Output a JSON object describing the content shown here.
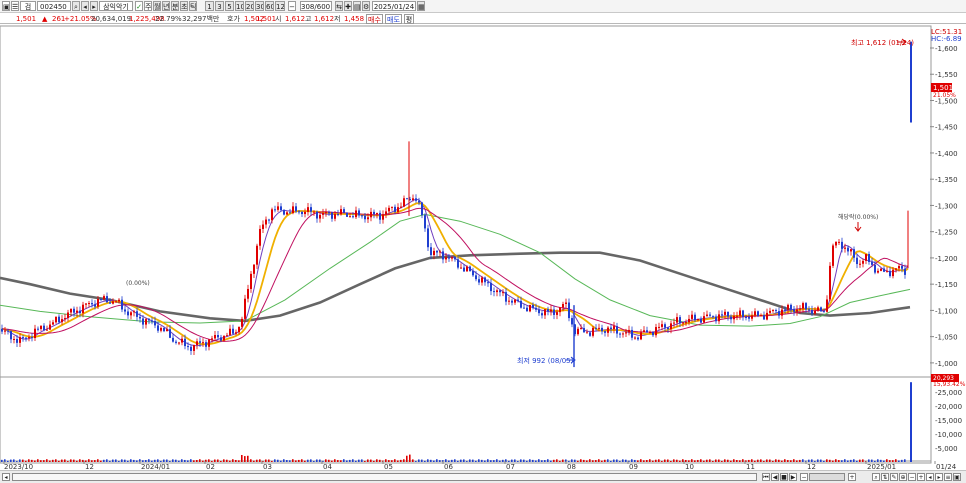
{
  "toolbar": {
    "period_buttons": [
      "1",
      "3",
      "5",
      "10",
      "20",
      "30",
      "60",
      "120"
    ],
    "type_buttons": [
      "주",
      "월",
      "년",
      "분",
      "초",
      "틱"
    ],
    "code": "002450",
    "name": "삼익악기",
    "count": "308",
    "total": "600",
    "date": "2025/01/24"
  },
  "quote": {
    "price": "1,501",
    "change": "261",
    "change_pct": "+21.05%",
    "volume": "20,634,019",
    "value": "1,225,498",
    "turnover": "22.79%",
    "amount": "32,297백만",
    "ask_label": "호가",
    "ask": "1,502",
    "bid": "1,501",
    "open_label": "시",
    "open": "1,612",
    "high_label": "고",
    "high": "1,612",
    "low_label": "저",
    "low": "1,458",
    "buy_button": "매수",
    "sell_button": "매도",
    "eval_button": "평"
  },
  "overlay": {
    "lc": "LC:51.31",
    "hc": "HC:-6.89",
    "max_label": "최고 1,612 (01/24)",
    "min_label": "최저 992 (08/05)",
    "event1": "(0.00%)",
    "event2": "해당락(0.00%)",
    "price_tag": "1,501",
    "price_pct": "21.05%",
    "vol_tag": "20,293",
    "vol_pct": "15,93.42%"
  },
  "colors": {
    "up": "#e00000",
    "down": "#1f3fd0",
    "ma5": "#7040c0",
    "ma10": "#f0b000",
    "ma20": "#c01060",
    "ma60": "#58b858",
    "ma120": "#666666"
  },
  "chart_data": {
    "type": "candlestick",
    "price_axis": {
      "ticks": [
        "1,600",
        "1,550",
        "1,500",
        "1,450",
        "1,400",
        "1,350",
        "1,300",
        "1,250",
        "1,200",
        "1,150",
        "1,100",
        "1,050",
        "1,000"
      ],
      "range": [
        975,
        1640
      ]
    },
    "volume_axis": {
      "ticks": [
        "25,000",
        "20,000",
        "15,000",
        "10,000",
        "5,000"
      ],
      "range": [
        0,
        30000
      ]
    },
    "x_ticks": [
      "2023/10",
      "12",
      "2024/01",
      "02",
      "03",
      "04",
      "05",
      "06",
      "07",
      "08",
      "09",
      "10",
      "11",
      "12",
      "2025/01",
      "01/24"
    ],
    "anchors": [
      [
        0,
        1065
      ],
      [
        10,
        1050
      ],
      [
        22,
        1042
      ],
      [
        35,
        1060
      ],
      [
        50,
        1072
      ],
      [
        65,
        1090
      ],
      [
        85,
        1108
      ],
      [
        100,
        1120
      ],
      [
        115,
        1118
      ],
      [
        125,
        1100
      ],
      [
        140,
        1085
      ],
      [
        158,
        1070
      ],
      [
        175,
        1042
      ],
      [
        190,
        1030
      ],
      [
        205,
        1040
      ],
      [
        220,
        1050
      ],
      [
        235,
        1058
      ],
      [
        242,
        1085
      ],
      [
        250,
        1160
      ],
      [
        260,
        1250
      ],
      [
        272,
        1292
      ],
      [
        290,
        1288
      ],
      [
        305,
        1290
      ],
      [
        322,
        1282
      ],
      [
        340,
        1285
      ],
      [
        360,
        1280
      ],
      [
        380,
        1282
      ],
      [
        400,
        1300
      ],
      [
        415,
        1320
      ],
      [
        422,
        1280
      ],
      [
        430,
        1210
      ],
      [
        445,
        1205
      ],
      [
        460,
        1185
      ],
      [
        475,
        1165
      ],
      [
        490,
        1145
      ],
      [
        505,
        1125
      ],
      [
        520,
        1110
      ],
      [
        535,
        1100
      ],
      [
        552,
        1095
      ],
      [
        565,
        1112
      ],
      [
        575,
        1060
      ],
      [
        590,
        1060
      ],
      [
        605,
        1065
      ],
      [
        620,
        1060
      ],
      [
        635,
        1050
      ],
      [
        650,
        1060
      ],
      [
        665,
        1070
      ],
      [
        680,
        1080
      ],
      [
        700,
        1085
      ],
      [
        720,
        1090
      ],
      [
        740,
        1090
      ],
      [
        760,
        1090
      ],
      [
        780,
        1100
      ],
      [
        800,
        1105
      ],
      [
        815,
        1100
      ],
      [
        825,
        1095
      ],
      [
        832,
        1220
      ],
      [
        840,
        1230
      ],
      [
        850,
        1210
      ],
      [
        858,
        1190
      ],
      [
        865,
        1200
      ],
      [
        875,
        1180
      ],
      [
        885,
        1170
      ],
      [
        895,
        1180
      ],
      [
        905,
        1175
      ],
      [
        910,
        1240
      ]
    ],
    "ma120": [
      [
        0,
        1162
      ],
      [
        30,
        1150
      ],
      [
        70,
        1132
      ],
      [
        110,
        1120
      ],
      [
        160,
        1098
      ],
      [
        210,
        1085
      ],
      [
        245,
        1080
      ],
      [
        280,
        1090
      ],
      [
        320,
        1115
      ],
      [
        360,
        1150
      ],
      [
        395,
        1180
      ],
      [
        430,
        1200
      ],
      [
        470,
        1205
      ],
      [
        520,
        1208
      ],
      [
        560,
        1210
      ],
      [
        600,
        1210
      ],
      [
        640,
        1195
      ],
      [
        680,
        1170
      ],
      [
        720,
        1145
      ],
      [
        760,
        1120
      ],
      [
        800,
        1095
      ],
      [
        830,
        1090
      ],
      [
        870,
        1095
      ],
      [
        910,
        1106
      ]
    ],
    "ma60": [
      [
        0,
        1110
      ],
      [
        40,
        1098
      ],
      [
        90,
        1088
      ],
      [
        150,
        1078
      ],
      [
        200,
        1076
      ],
      [
        245,
        1080
      ],
      [
        285,
        1120
      ],
      [
        330,
        1180
      ],
      [
        370,
        1230
      ],
      [
        400,
        1270
      ],
      [
        425,
        1283
      ],
      [
        460,
        1270
      ],
      [
        500,
        1245
      ],
      [
        540,
        1210
      ],
      [
        575,
        1160
      ],
      [
        610,
        1120
      ],
      [
        650,
        1090
      ],
      [
        700,
        1072
      ],
      [
        750,
        1070
      ],
      [
        790,
        1075
      ],
      [
        820,
        1088
      ],
      [
        850,
        1115
      ],
      [
        880,
        1128
      ],
      [
        910,
        1140
      ]
    ],
    "series": [
      {
        "name": "MA5",
        "lag": 4
      },
      {
        "name": "MA10",
        "lag": 9
      },
      {
        "name": "MA20",
        "lag": 18
      }
    ],
    "last_bar": {
      "open": 1458,
      "high": 1612,
      "low": 1458,
      "close": 1612
    },
    "last_volume": 28500
  }
}
